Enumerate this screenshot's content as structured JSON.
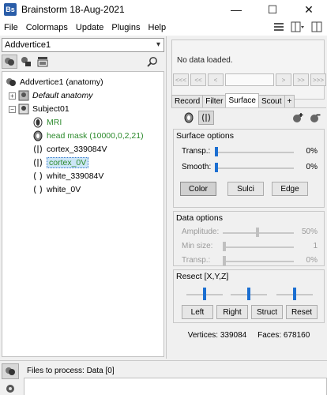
{
  "window": {
    "app_logo": "Bs",
    "title": "Brainstorm 18-Aug-2021",
    "minimize": "—",
    "maximize": "☐",
    "close": "✕"
  },
  "menu": {
    "items": [
      "File",
      "Colormaps",
      "Update",
      "Plugins",
      "Help"
    ]
  },
  "protocol": {
    "selected": "Addvertice1"
  },
  "tree": {
    "root": "Addvertice1 (anatomy)",
    "default_anatomy": "Default anatomy",
    "subject": "Subject01",
    "items": [
      "MRI",
      "head mask (10000,0,2,21)",
      "cortex_339084V",
      "cortex_0V",
      "white_339084V",
      "white_0V"
    ],
    "expander_plus": "+",
    "expander_minus": "−"
  },
  "viewer": {
    "no_data": "No data loaded.",
    "nav_buttons": [
      "<<<",
      "<<",
      "<",
      ">",
      ">>",
      ">>>"
    ]
  },
  "tabs": [
    "Record",
    "Filter",
    "Surface",
    "Scout",
    "+"
  ],
  "active_tab": "Surface",
  "surface_options": {
    "title": "Surface options",
    "transp_label": "Transp.:",
    "transp_value": "0%",
    "smooth_label": "Smooth:",
    "smooth_value": "0%",
    "buttons": [
      "Color",
      "Sulci",
      "Edge"
    ]
  },
  "data_options": {
    "title": "Data options",
    "amplitude_label": "Amplitude:",
    "amplitude_value": "50%",
    "minsize_label": "Min size:",
    "minsize_value": "1",
    "transp_label": "Transp.:",
    "transp_value": "0%"
  },
  "resect": {
    "title": "Resect [X,Y,Z]",
    "buttons": [
      "Left",
      "Right",
      "Struct",
      "Reset"
    ]
  },
  "stats": {
    "vertices": "Vertices: 339084",
    "faces": "Faces: 678160"
  },
  "process": {
    "files_label": "Files to process: Data [0]"
  },
  "colors": {
    "accent_blue": "#1c6fd1",
    "green_text": "#2e8b2e",
    "selection_bg": "#cde6f7"
  }
}
